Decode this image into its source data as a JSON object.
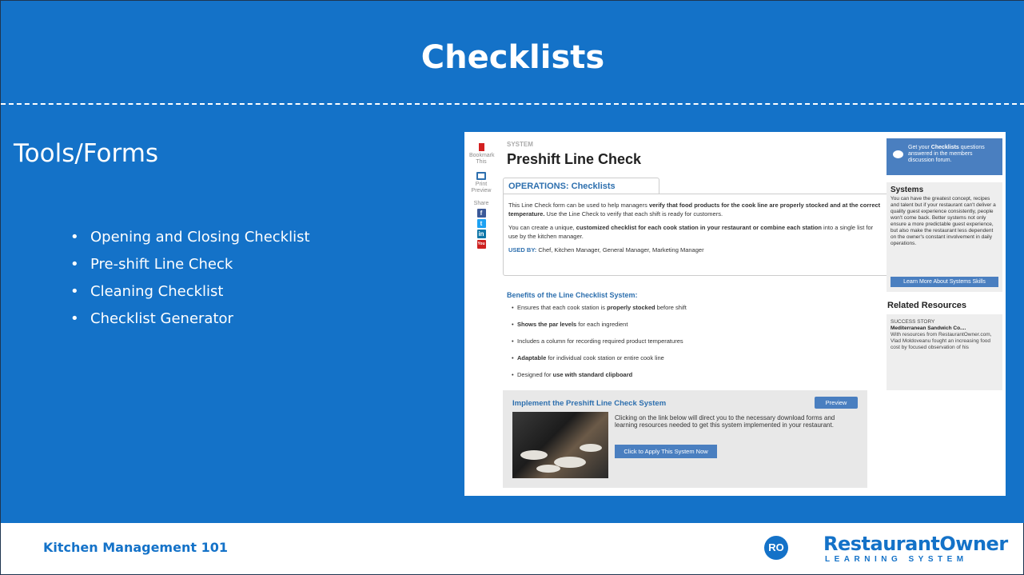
{
  "slide": {
    "title": "Checklists",
    "subtitle": "Tools/Forms",
    "bullets": [
      "Opening and Closing Checklist",
      "Pre-shift Line Check",
      "Cleaning Checklist",
      "Checklist Generator"
    ],
    "footer_course": "Kitchen Management 101",
    "logo": {
      "monogram": "RO",
      "name": "RestaurantOwner",
      "tagline": "LEARNING SYSTEM"
    }
  },
  "screenshot": {
    "sidebar": {
      "bookmark": "Bookmark This",
      "print": "Print Preview",
      "share": "Share",
      "social": [
        {
          "icon": "facebook-icon",
          "glyph": "f",
          "color": "#3b5998"
        },
        {
          "icon": "twitter-icon",
          "glyph": "t",
          "color": "#1da1f2"
        },
        {
          "icon": "linkedin-icon",
          "glyph": "in",
          "color": "#0e76a8"
        },
        {
          "icon": "youtube-icon",
          "glyph": "You",
          "color": "#cd201f"
        }
      ]
    },
    "section_label": "SYSTEM",
    "page_title": "Preshift Line Check",
    "tab_label": "OPERATIONS: Checklists",
    "desc": {
      "p1_a": "This Line Check form can be used to help managers ",
      "p1_b": "verify that food products for the cook line are properly stocked and at the correct temperature.",
      "p1_c": " Use the Line Check to verify that each shift is ready for customers.",
      "p2_a": "You can create a unique, ",
      "p2_b": "customized checklist for each cook station in your restaurant or combine each station",
      "p2_c": " into a single list for use by the kitchen manager.",
      "used_by_label": "USED BY:",
      "used_by_value": " Chef, Kitchen Manager, General Manager, Marketing Manager"
    },
    "benefits_heading": "Benefits of the Line Checklist System:",
    "benefits": [
      {
        "pre": "Ensures that each cook station is ",
        "bold": "properly stocked",
        "post": " before shift"
      },
      {
        "pre": "",
        "bold": "Shows the par levels",
        "post": " for each ingredient"
      },
      {
        "pre": "Includes a column for recording required product temperatures",
        "bold": "",
        "post": ""
      },
      {
        "pre": "",
        "bold": "Adaptable",
        "post": " for individual cook station or entire cook line"
      },
      {
        "pre": "Designed for ",
        "bold": "use with standard clipboard",
        "post": ""
      }
    ],
    "implement": {
      "heading": "Implement the Preshift Line Check System",
      "preview_label": "Preview",
      "text": "Clicking on the link below will direct you to the necessary download forms and learning resources needed to get this system implemented in your restaurant.",
      "apply_label": "Click to Apply This System Now"
    },
    "forum": {
      "pre": "Get your ",
      "bold": "Checklists",
      "post": " questions answered in the members discussion forum."
    },
    "systems": {
      "heading": "Systems",
      "text": "You can have the greatest concept, recipes and talent but if your restaurant can't deliver a quality guest experience consistently, people won't come back. Better systems not only ensure a more predictable guest experience, but also make the restaurant less dependent on the owner's constant involvement in daily operations.",
      "button": "Learn More About Systems Skills"
    },
    "related": {
      "heading": "Related Resources",
      "kind": "SUCCESS STORY",
      "title": "Mediterranean Sandwich Co....",
      "text": "With resources from RestaurantOwner.com, Vlad Moldoveanu fought an increasing food cost by focused observation of his"
    }
  },
  "colors": {
    "slide_blue": "#1472c8",
    "link_blue": "#2d6fae",
    "button_blue": "#4a7fc0"
  }
}
